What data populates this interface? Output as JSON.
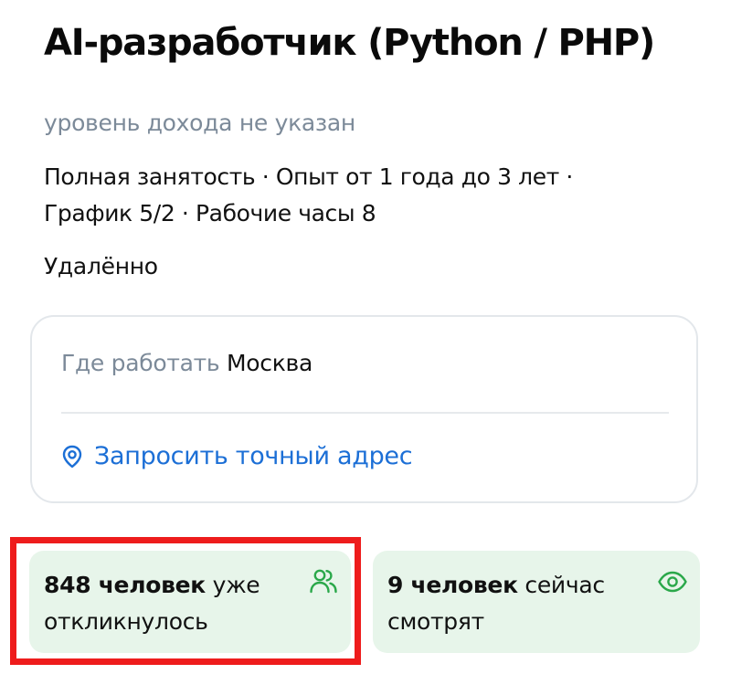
{
  "vacancy": {
    "title": "AI-разработчик (Python / PHP)",
    "salary": "уровень дохода не указан",
    "conditions_line1": "Полная занятость · Опыт от 1 года до 3 лет ·",
    "conditions_line2": "График 5/2 · Рабочие часы 8",
    "work_format": "Удалённо"
  },
  "location": {
    "label": "Где работать",
    "city": "Москва",
    "request_address_link": "Запросить точный адрес",
    "link_icon": "location-pin-icon"
  },
  "stats": {
    "responses": {
      "count_text": "848 человек",
      "rest_line1": " уже",
      "line2": "откликнулось",
      "icon": "people-icon"
    },
    "viewers": {
      "count_text": "9 человек",
      "rest_line1": " сейчас",
      "line2": "смотрят",
      "icon": "eye-icon"
    }
  },
  "colors": {
    "link_blue": "#1c6fd6",
    "muted_gray": "#7c8a99",
    "stat_bg_green": "#e7f5ea",
    "stat_icon_green": "#2aa84a",
    "highlight_red": "#ee1c1c"
  }
}
